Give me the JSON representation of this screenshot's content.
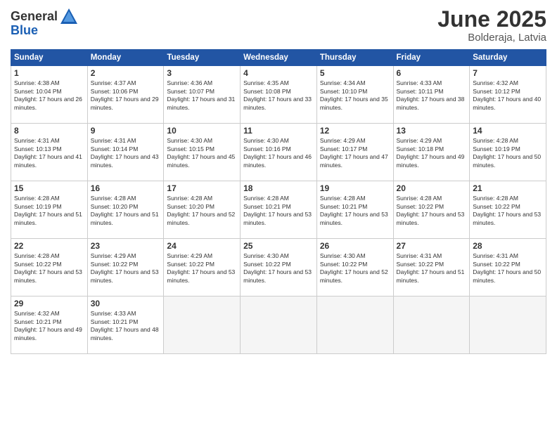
{
  "logo": {
    "general": "General",
    "blue": "Blue"
  },
  "title": {
    "month": "June 2025",
    "location": "Bolderaja, Latvia"
  },
  "header_days": [
    "Sunday",
    "Monday",
    "Tuesday",
    "Wednesday",
    "Thursday",
    "Friday",
    "Saturday"
  ],
  "weeks": [
    [
      {
        "day": "1",
        "sunrise": "Sunrise: 4:38 AM",
        "sunset": "Sunset: 10:04 PM",
        "daylight": "Daylight: 17 hours and 26 minutes."
      },
      {
        "day": "2",
        "sunrise": "Sunrise: 4:37 AM",
        "sunset": "Sunset: 10:06 PM",
        "daylight": "Daylight: 17 hours and 29 minutes."
      },
      {
        "day": "3",
        "sunrise": "Sunrise: 4:36 AM",
        "sunset": "Sunset: 10:07 PM",
        "daylight": "Daylight: 17 hours and 31 minutes."
      },
      {
        "day": "4",
        "sunrise": "Sunrise: 4:35 AM",
        "sunset": "Sunset: 10:08 PM",
        "daylight": "Daylight: 17 hours and 33 minutes."
      },
      {
        "day": "5",
        "sunrise": "Sunrise: 4:34 AM",
        "sunset": "Sunset: 10:10 PM",
        "daylight": "Daylight: 17 hours and 35 minutes."
      },
      {
        "day": "6",
        "sunrise": "Sunrise: 4:33 AM",
        "sunset": "Sunset: 10:11 PM",
        "daylight": "Daylight: 17 hours and 38 minutes."
      },
      {
        "day": "7",
        "sunrise": "Sunrise: 4:32 AM",
        "sunset": "Sunset: 10:12 PM",
        "daylight": "Daylight: 17 hours and 40 minutes."
      }
    ],
    [
      {
        "day": "8",
        "sunrise": "Sunrise: 4:31 AM",
        "sunset": "Sunset: 10:13 PM",
        "daylight": "Daylight: 17 hours and 41 minutes."
      },
      {
        "day": "9",
        "sunrise": "Sunrise: 4:31 AM",
        "sunset": "Sunset: 10:14 PM",
        "daylight": "Daylight: 17 hours and 43 minutes."
      },
      {
        "day": "10",
        "sunrise": "Sunrise: 4:30 AM",
        "sunset": "Sunset: 10:15 PM",
        "daylight": "Daylight: 17 hours and 45 minutes."
      },
      {
        "day": "11",
        "sunrise": "Sunrise: 4:30 AM",
        "sunset": "Sunset: 10:16 PM",
        "daylight": "Daylight: 17 hours and 46 minutes."
      },
      {
        "day": "12",
        "sunrise": "Sunrise: 4:29 AM",
        "sunset": "Sunset: 10:17 PM",
        "daylight": "Daylight: 17 hours and 47 minutes."
      },
      {
        "day": "13",
        "sunrise": "Sunrise: 4:29 AM",
        "sunset": "Sunset: 10:18 PM",
        "daylight": "Daylight: 17 hours and 49 minutes."
      },
      {
        "day": "14",
        "sunrise": "Sunrise: 4:28 AM",
        "sunset": "Sunset: 10:19 PM",
        "daylight": "Daylight: 17 hours and 50 minutes."
      }
    ],
    [
      {
        "day": "15",
        "sunrise": "Sunrise: 4:28 AM",
        "sunset": "Sunset: 10:19 PM",
        "daylight": "Daylight: 17 hours and 51 minutes."
      },
      {
        "day": "16",
        "sunrise": "Sunrise: 4:28 AM",
        "sunset": "Sunset: 10:20 PM",
        "daylight": "Daylight: 17 hours and 51 minutes."
      },
      {
        "day": "17",
        "sunrise": "Sunrise: 4:28 AM",
        "sunset": "Sunset: 10:20 PM",
        "daylight": "Daylight: 17 hours and 52 minutes."
      },
      {
        "day": "18",
        "sunrise": "Sunrise: 4:28 AM",
        "sunset": "Sunset: 10:21 PM",
        "daylight": "Daylight: 17 hours and 53 minutes."
      },
      {
        "day": "19",
        "sunrise": "Sunrise: 4:28 AM",
        "sunset": "Sunset: 10:21 PM",
        "daylight": "Daylight: 17 hours and 53 minutes."
      },
      {
        "day": "20",
        "sunrise": "Sunrise: 4:28 AM",
        "sunset": "Sunset: 10:22 PM",
        "daylight": "Daylight: 17 hours and 53 minutes."
      },
      {
        "day": "21",
        "sunrise": "Sunrise: 4:28 AM",
        "sunset": "Sunset: 10:22 PM",
        "daylight": "Daylight: 17 hours and 53 minutes."
      }
    ],
    [
      {
        "day": "22",
        "sunrise": "Sunrise: 4:28 AM",
        "sunset": "Sunset: 10:22 PM",
        "daylight": "Daylight: 17 hours and 53 minutes."
      },
      {
        "day": "23",
        "sunrise": "Sunrise: 4:29 AM",
        "sunset": "Sunset: 10:22 PM",
        "daylight": "Daylight: 17 hours and 53 minutes."
      },
      {
        "day": "24",
        "sunrise": "Sunrise: 4:29 AM",
        "sunset": "Sunset: 10:22 PM",
        "daylight": "Daylight: 17 hours and 53 minutes."
      },
      {
        "day": "25",
        "sunrise": "Sunrise: 4:30 AM",
        "sunset": "Sunset: 10:22 PM",
        "daylight": "Daylight: 17 hours and 53 minutes."
      },
      {
        "day": "26",
        "sunrise": "Sunrise: 4:30 AM",
        "sunset": "Sunset: 10:22 PM",
        "daylight": "Daylight: 17 hours and 52 minutes."
      },
      {
        "day": "27",
        "sunrise": "Sunrise: 4:31 AM",
        "sunset": "Sunset: 10:22 PM",
        "daylight": "Daylight: 17 hours and 51 minutes."
      },
      {
        "day": "28",
        "sunrise": "Sunrise: 4:31 AM",
        "sunset": "Sunset: 10:22 PM",
        "daylight": "Daylight: 17 hours and 50 minutes."
      }
    ],
    [
      {
        "day": "29",
        "sunrise": "Sunrise: 4:32 AM",
        "sunset": "Sunset: 10:21 PM",
        "daylight": "Daylight: 17 hours and 49 minutes."
      },
      {
        "day": "30",
        "sunrise": "Sunrise: 4:33 AM",
        "sunset": "Sunset: 10:21 PM",
        "daylight": "Daylight: 17 hours and 48 minutes."
      },
      null,
      null,
      null,
      null,
      null
    ]
  ]
}
